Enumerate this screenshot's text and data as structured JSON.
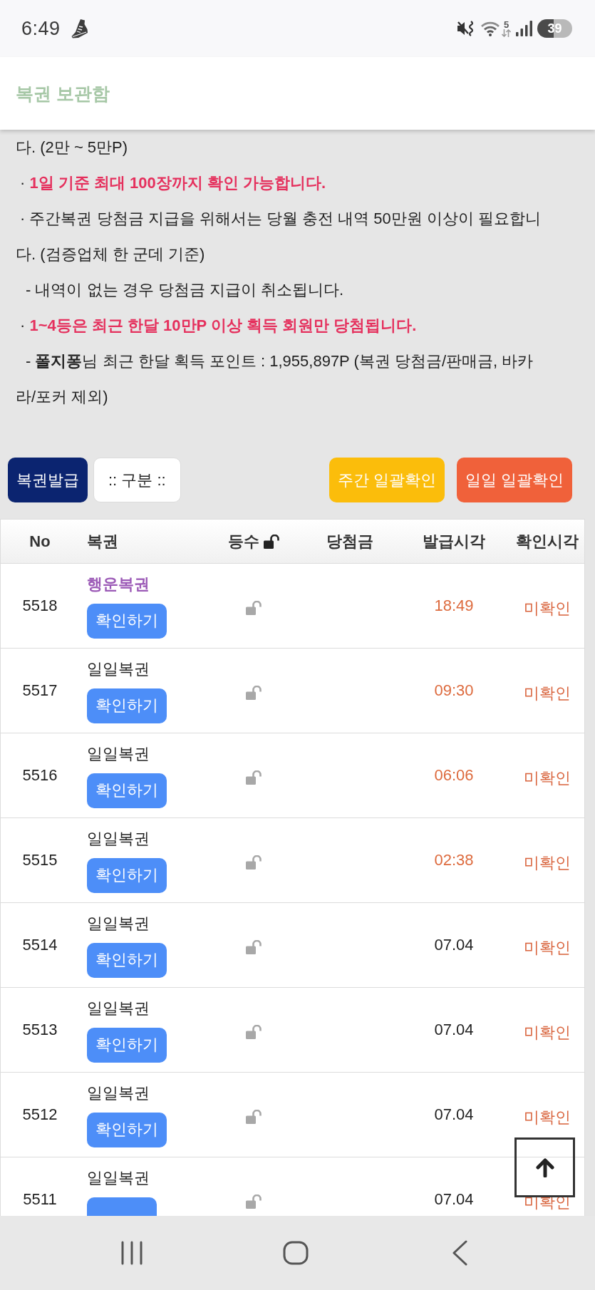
{
  "status_bar": {
    "time": "6:49",
    "wifi_label": "5",
    "battery": "39"
  },
  "header": {
    "title": "복권 보관함"
  },
  "notices": [
    {
      "kind": "continuation",
      "text": "다. (2만 ~ 5만P)",
      "emphasis": false
    },
    {
      "kind": "bullet",
      "marker": "·",
      "text": "1일 기준 최대 100장까지 확인 가능합니다.",
      "emphasis": true
    },
    {
      "kind": "bullet",
      "marker": "·",
      "text": "주간복권 당첨금 지급을 위해서는 당월 충전 내역 50만원 이상이 필요합니다. (검증업체 한 군데 기준)",
      "emphasis": false
    },
    {
      "kind": "sub",
      "marker": "-",
      "text": "내역이 없는 경우 당첨금 지급이 취소됩니다.",
      "emphasis": false
    },
    {
      "kind": "bullet",
      "marker": "·",
      "text": "1~4등은 최근 한달 10만P 이상 획득 회원만 당첨됩니다.",
      "emphasis": true
    },
    {
      "kind": "sub",
      "marker": "-",
      "text": "**폴지퐁**님 최근 한달 획득 포인트 : 1,955,897P (복권 당첨금/판매금, 바카라/포커 제외)",
      "emphasis": false
    }
  ],
  "toolbar": {
    "left": [
      {
        "label": "복권발급",
        "kind": "issue"
      },
      {
        "label": ":: 구분 ::",
        "kind": "filter"
      }
    ],
    "right": [
      {
        "label": "주간 일괄확인",
        "kind": "weekly"
      },
      {
        "label": "일일 일괄확인",
        "kind": "daily"
      }
    ]
  },
  "table": {
    "columns": [
      {
        "label": "No",
        "kind": "number"
      },
      {
        "label": "복권",
        "kind": "ticket"
      },
      {
        "label": "등수",
        "kind": "rank"
      },
      {
        "label": "당첨금",
        "kind": "prize"
      },
      {
        "label": "발급시각",
        "kind": "issued"
      },
      {
        "label": "확인시각",
        "kind": "checked"
      }
    ],
    "rows": [
      {
        "no": "5518",
        "ticket": {
          "name": "행운복권",
          "kind": "lucky"
        },
        "button": "확인하기",
        "rank_locked": false,
        "issued": "18:49",
        "issued_today": true,
        "status": "미확인"
      },
      {
        "no": "5517",
        "ticket": {
          "name": "일일복권",
          "kind": "daily"
        },
        "button": "확인하기",
        "rank_locked": false,
        "issued": "09:30",
        "issued_today": true,
        "status": "미확인"
      },
      {
        "no": "5516",
        "ticket": {
          "name": "일일복권",
          "kind": "daily"
        },
        "button": "확인하기",
        "rank_locked": false,
        "issued": "06:06",
        "issued_today": true,
        "status": "미확인"
      },
      {
        "no": "5515",
        "ticket": {
          "name": "일일복권",
          "kind": "daily"
        },
        "button": "확인하기",
        "rank_locked": false,
        "issued": "02:38",
        "issued_today": true,
        "status": "미확인"
      },
      {
        "no": "5514",
        "ticket": {
          "name": "일일복권",
          "kind": "daily"
        },
        "button": "확인하기",
        "rank_locked": false,
        "issued": "07.04",
        "issued_today": false,
        "status": "미확인"
      },
      {
        "no": "5513",
        "ticket": {
          "name": "일일복권",
          "kind": "daily"
        },
        "button": "확인하기",
        "rank_locked": false,
        "issued": "07.04",
        "issued_today": false,
        "status": "미확인"
      },
      {
        "no": "5512",
        "ticket": {
          "name": "일일복권",
          "kind": "daily"
        },
        "button": "확인하기",
        "rank_locked": false,
        "issued": "07.04",
        "issued_today": false,
        "status": "미확인"
      },
      {
        "no": "5511",
        "ticket": {
          "name": "일일복권",
          "kind": "daily"
        },
        "rank_locked": false,
        "issued": "07.04",
        "issued_today": false,
        "status": "미확인"
      }
    ]
  }
}
